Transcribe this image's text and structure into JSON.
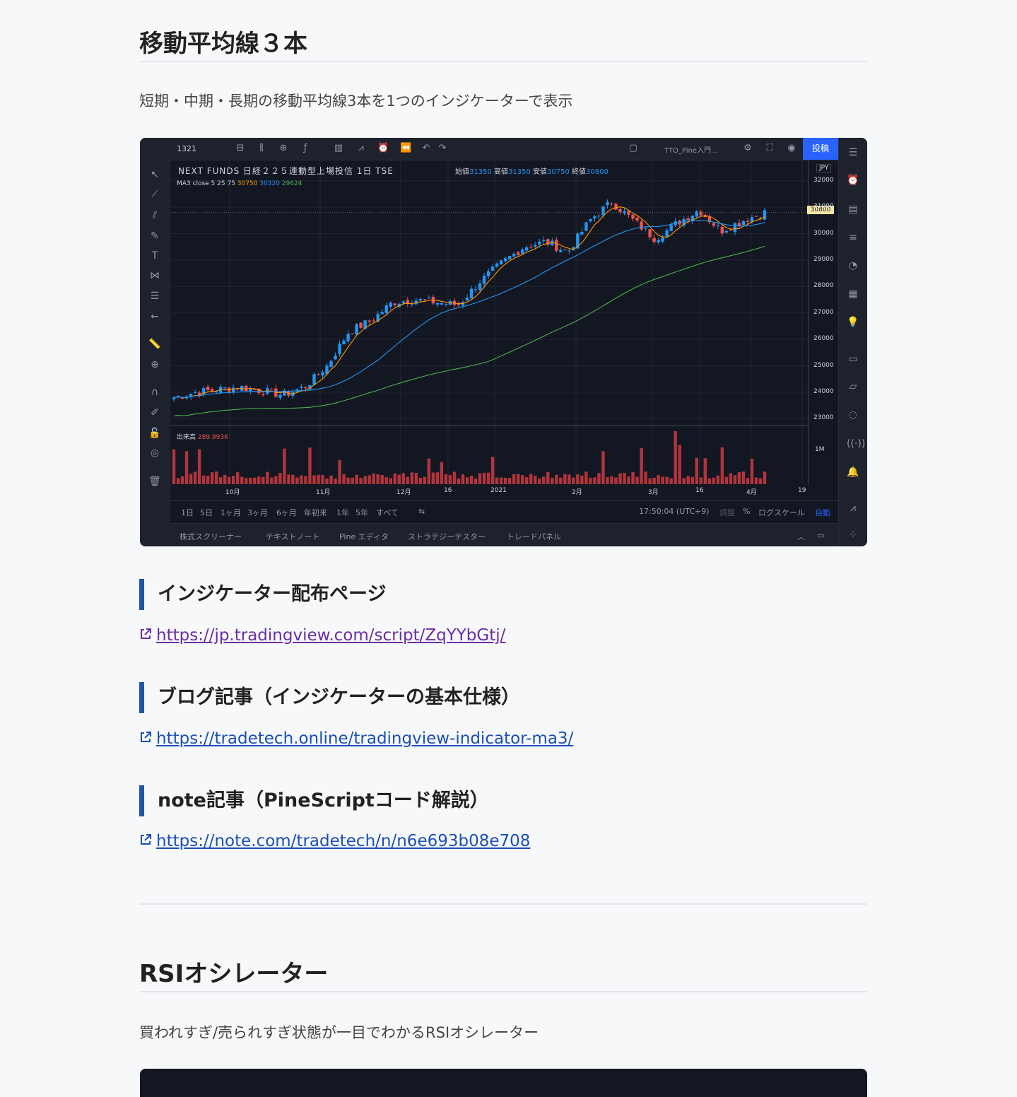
{
  "sections": [
    {
      "title": "移動平均線３本",
      "description": "短期・中期・長期の移動平均線3本を1つのインジケーターで表示"
    },
    {
      "title": "RSIオシレーター",
      "description": "買われすぎ/売られすぎ状態が一目でわかるRSIオシレーター"
    }
  ],
  "links": [
    {
      "heading": "インジケーター配布ページ",
      "url": "https://jp.tradingview.com/script/ZqYYbGtj/"
    },
    {
      "heading": "ブログ記事（インジケーターの基本仕様）",
      "url": "https://tradetech.online/tradingview-indicator-ma3/"
    },
    {
      "heading": "note記事（PineScriptコード解説）",
      "url": "https://note.com/tradetech/n/n6e693b08e708"
    }
  ],
  "colors": {
    "accent_bar": "#1e56a8",
    "link": "#1a4fb8",
    "link_visited": "#6b2fa5",
    "chart_bg": "#131722",
    "up_candle": "#2196f3",
    "down_candle": "#ef5350",
    "ma_short": "#ff9800",
    "ma_mid": "#2196f3",
    "ma_long": "#4caf50",
    "volume": "#b2353b"
  },
  "tradingview": {
    "ticker": "1321",
    "post_button": "投稿",
    "account": "TTO_Pine入門...",
    "symbol": "NEXT FUNDS 日経２２５連動型上場投信 1日 TSE",
    "ohlc": {
      "open_label": "始値",
      "open": "31350",
      "high_label": "高値",
      "high": "31350",
      "low_label": "安値",
      "low": "30750",
      "close_label": "終値",
      "close": "30800"
    },
    "ma_label": "MA3 close 5 25 75",
    "ma_values": [
      "30750",
      "30320",
      "29624"
    ],
    "volume_label": "出来高",
    "volume_value": "289.993K",
    "currency": "JPY",
    "last_price_tag": "30800",
    "price_axis": [
      "32000",
      "31000",
      "30000",
      "29000",
      "28000",
      "27000",
      "26000",
      "25000",
      "24000",
      "23000"
    ],
    "volume_axis": "1M",
    "time_axis": [
      "10月",
      "11月",
      "12月",
      "16",
      "2021",
      "2月",
      "3月",
      "16",
      "4月",
      "19"
    ],
    "ranges": [
      "1日",
      "5日",
      "1ヶ月",
      "3ヶ月",
      "6ヶ月",
      "年初来",
      "1年",
      "5年",
      "すべて"
    ],
    "clock": "17:50:04 (UTC+9)",
    "scale_options": [
      "調整",
      "%",
      "ログスケール",
      "自動"
    ],
    "panel_tabs": [
      "株式スクリーナー",
      "テキストノート",
      "Pine エディタ",
      "ストラテジーテスター",
      "トレードパネル"
    ]
  },
  "chart_data": {
    "type": "candlestick",
    "title": "NEXT FUNDS 日経２２５連動型上場投信 1日 TSE",
    "x": [
      "10月",
      "11月",
      "12月",
      "16",
      "2021",
      "2月",
      "3月",
      "16",
      "4月",
      "19"
    ],
    "ylim": [
      22500,
      32500
    ],
    "series": [
      {
        "name": "MA3 close 5 25 75",
        "values": [
          30750,
          30320,
          29624
        ]
      }
    ],
    "close_path": [
      23800,
      24000,
      24100,
      24200,
      24050,
      23900,
      24200,
      25000,
      26300,
      26700,
      27400,
      27500,
      27400,
      27300,
      28200,
      28900,
      29500,
      29700,
      29300,
      30500,
      31200,
      30500,
      29800,
      30400,
      30900,
      30100,
      30500,
      30800
    ]
  }
}
